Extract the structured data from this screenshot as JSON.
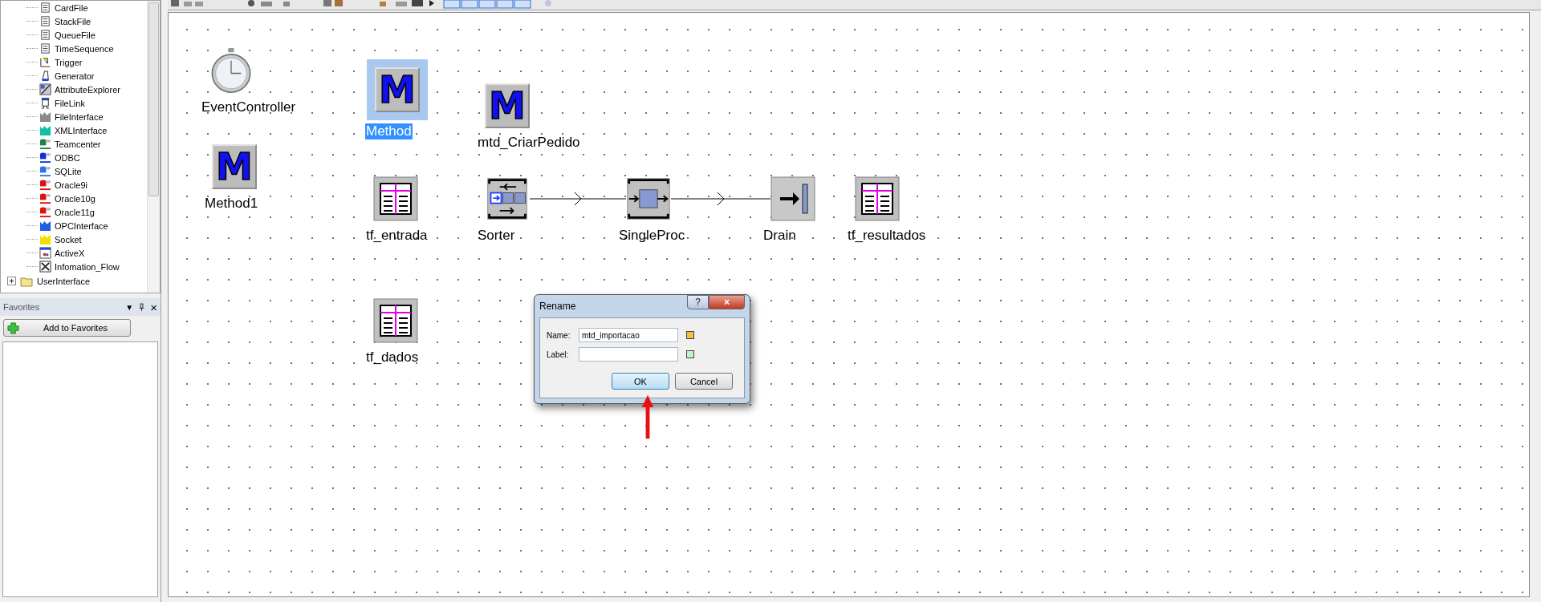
{
  "tree": {
    "items": [
      {
        "label": "CardFile",
        "kind": "file"
      },
      {
        "label": "StackFile",
        "kind": "file"
      },
      {
        "label": "QueueFile",
        "kind": "file"
      },
      {
        "label": "TimeSequence",
        "kind": "file"
      },
      {
        "label": "Trigger",
        "kind": "trigger"
      },
      {
        "label": "Generator",
        "kind": "generator"
      },
      {
        "label": "AttributeExplorer",
        "kind": "explorer"
      },
      {
        "label": "FileLink",
        "kind": "link"
      },
      {
        "label": "FileInterface",
        "kind": "interface",
        "color": "#8a8a8a"
      },
      {
        "label": "XMLInterface",
        "kind": "interface",
        "color": "#10c0a0"
      },
      {
        "label": "Teamcenter",
        "kind": "database",
        "color": "#208040"
      },
      {
        "label": "ODBC",
        "kind": "database",
        "color": "#1030e0"
      },
      {
        "label": "SQLite",
        "kind": "database",
        "color": "#3070f0"
      },
      {
        "label": "Oracle9i",
        "kind": "database",
        "color": "#e01010"
      },
      {
        "label": "Oracle10g",
        "kind": "database",
        "color": "#e01010"
      },
      {
        "label": "Oracle11g",
        "kind": "database",
        "color": "#e01010"
      },
      {
        "label": "OPCInterface",
        "kind": "interface",
        "color": "#2060e0"
      },
      {
        "label": "Socket",
        "kind": "interface",
        "color": "#f0e000"
      },
      {
        "label": "ActiveX",
        "kind": "activex"
      },
      {
        "label": "Infomation_Flow",
        "kind": "flow"
      }
    ],
    "folders": [
      {
        "label": "UserInterface",
        "expanded": false
      }
    ]
  },
  "favorites": {
    "title": "Favorites",
    "menu_glyph": "▼",
    "close_glyph": "×",
    "add_button": "Add to Favorites"
  },
  "canvas": {
    "objects": [
      {
        "label": "EventController",
        "kind": "clock",
        "selected": false
      },
      {
        "label": "Method1",
        "kind": "method",
        "glyph": "M",
        "selected": false
      },
      {
        "label": "Method",
        "kind": "method",
        "glyph": "M",
        "selected": true
      },
      {
        "label": "mtd_CriarPedido",
        "kind": "method",
        "glyph": "M",
        "selected": false
      },
      {
        "label": "tf_entrada",
        "kind": "table",
        "selected": false
      },
      {
        "label": "Sorter",
        "kind": "sorter",
        "selected": false
      },
      {
        "label": "SingleProc",
        "kind": "singleproc",
        "selected": false
      },
      {
        "label": "Drain",
        "kind": "drain",
        "selected": false
      },
      {
        "label": "tf_resultados",
        "kind": "table",
        "selected": false
      },
      {
        "label": "tf_dados",
        "kind": "table",
        "selected": false
      }
    ]
  },
  "dialog": {
    "title": "Rename",
    "help_glyph": "?",
    "close_glyph": "×",
    "fields": [
      {
        "label": "Name:",
        "value": "mtd_importacao"
      },
      {
        "label": "Label:"
      }
    ],
    "buttons": [
      {
        "label": "OK",
        "default": true
      },
      {
        "label": "Cancel",
        "default": false
      }
    ]
  }
}
